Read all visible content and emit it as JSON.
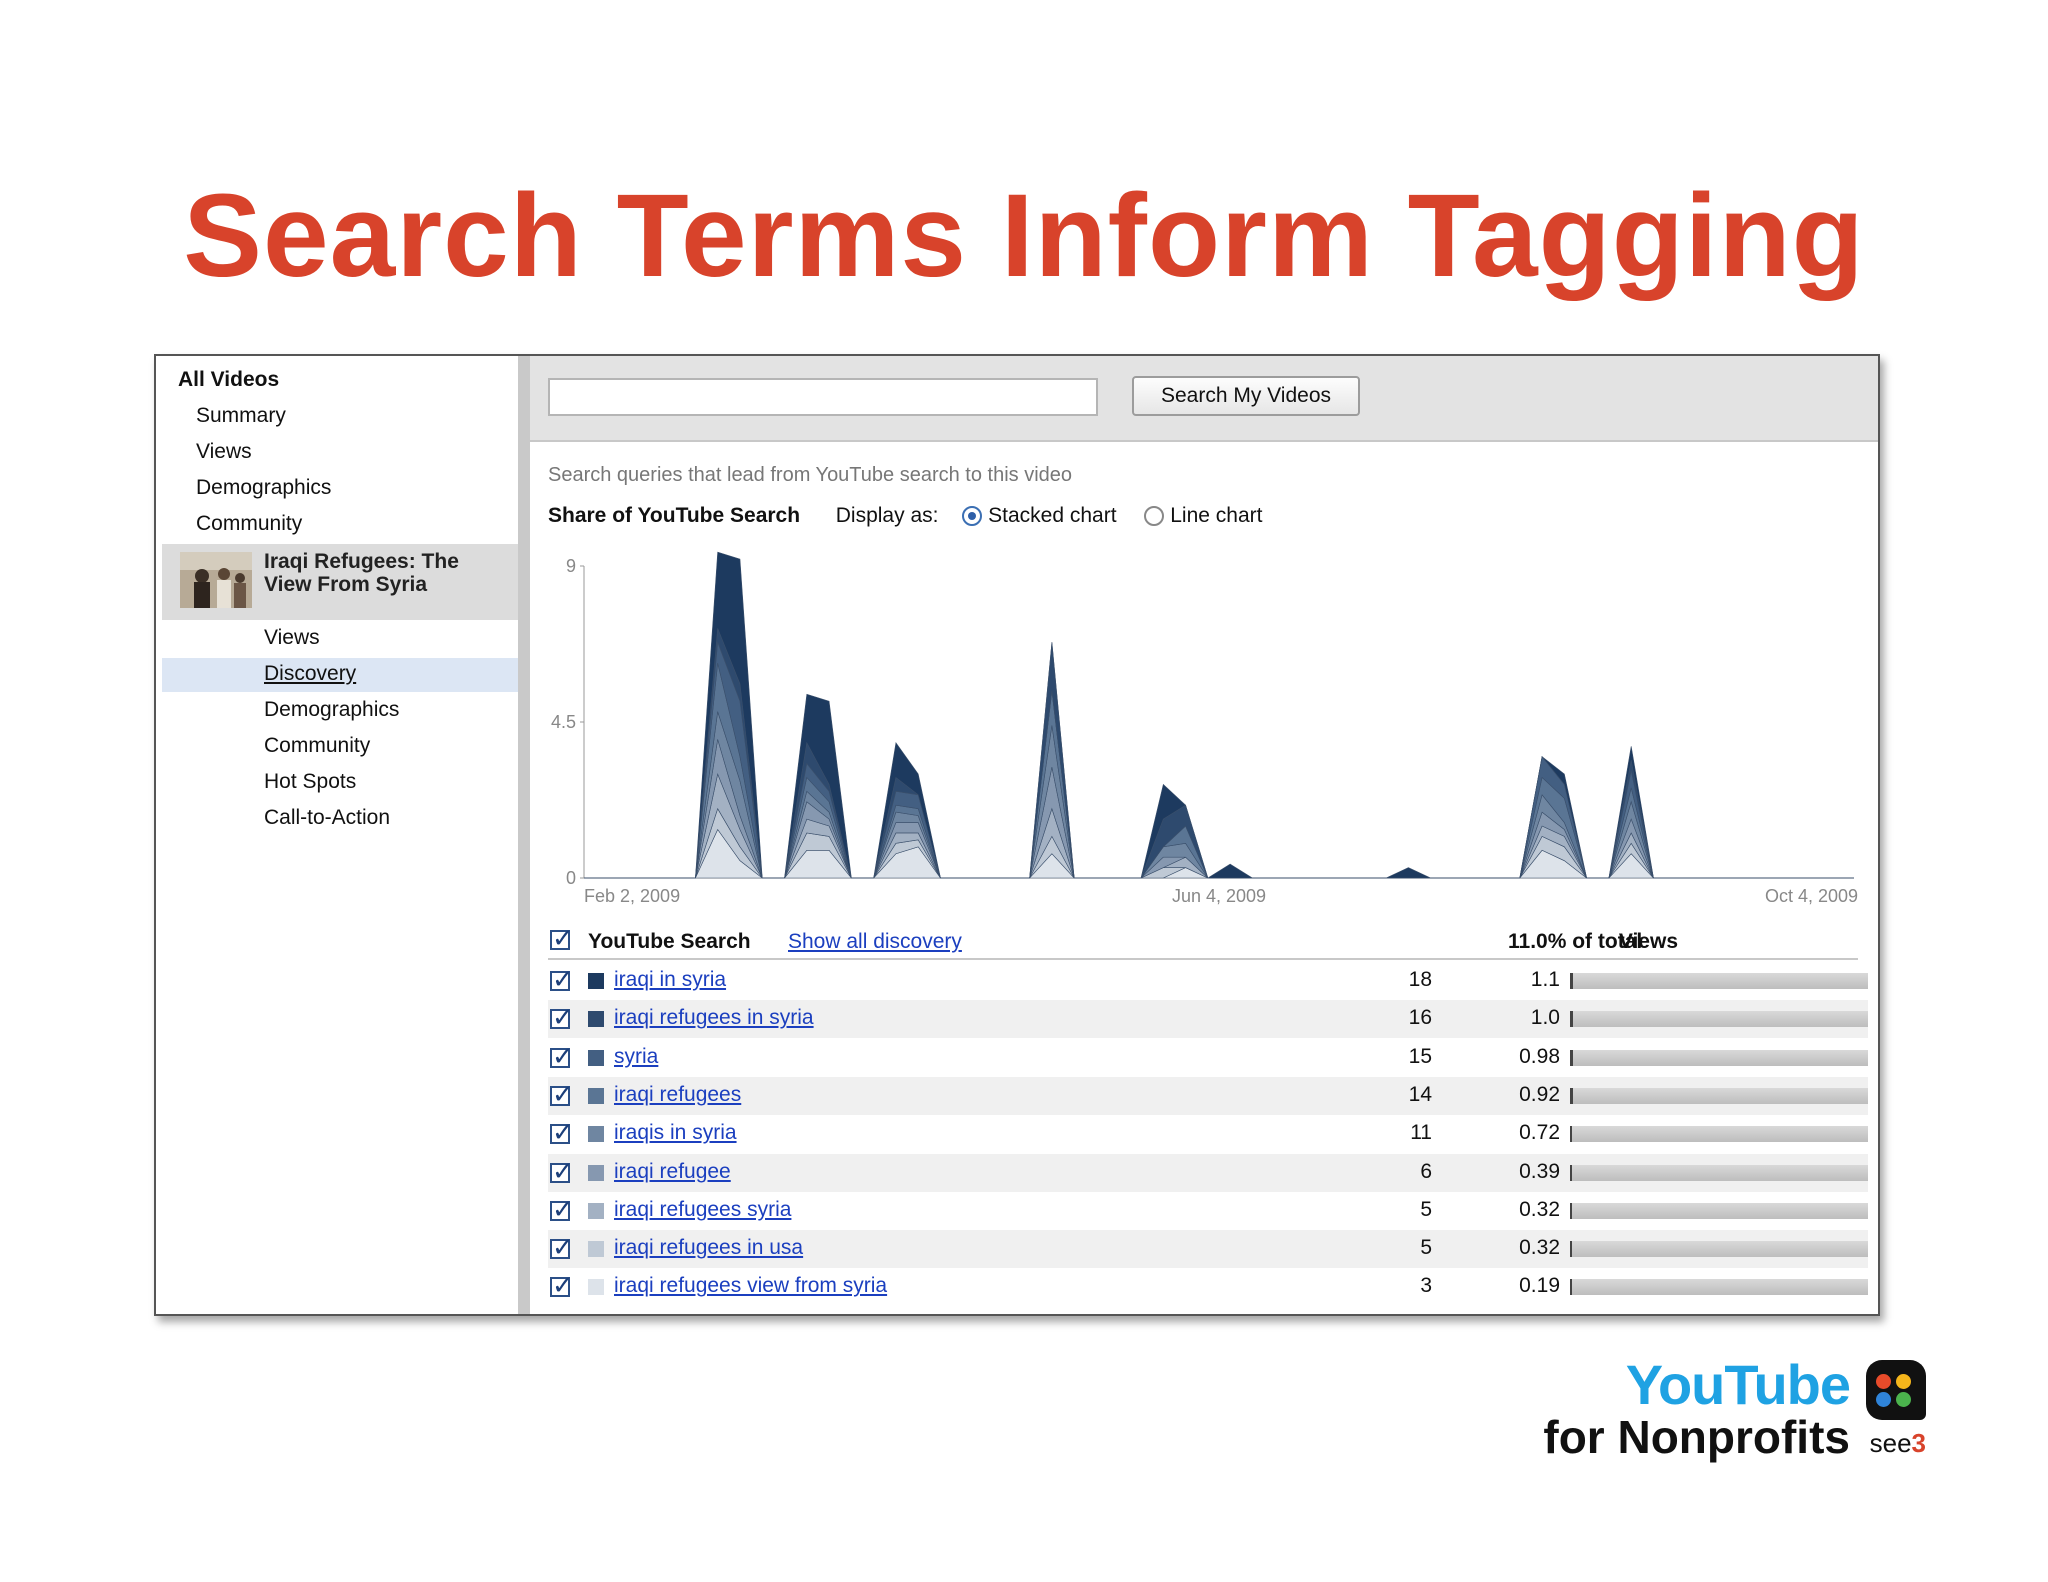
{
  "slide_title": "Search Terms Inform Tagging",
  "sidebar": {
    "all_videos": "All Videos",
    "items": [
      "Summary",
      "Views",
      "Demographics",
      "Community"
    ],
    "video_title_line1": "Iraqi Refugees: The",
    "video_title_line2": "View From Syria",
    "video_items": [
      "Views",
      "Discovery",
      "Demographics",
      "Community",
      "Hot Spots",
      "Call-to-Action"
    ],
    "selected": "Discovery"
  },
  "search": {
    "input_value": "",
    "button_label": "Search My Videos"
  },
  "discovery": {
    "description": "Search queries that lead from YouTube search to this video",
    "share_label": "Share of YouTube Search",
    "display_as_label": "Display as:",
    "stacked_label": "Stacked chart",
    "line_label": "Line chart",
    "selected_display": "Stacked chart"
  },
  "chart_data": {
    "type": "area",
    "stacked": true,
    "yticks": [
      "9",
      "4.5",
      "0"
    ],
    "ylim": [
      0,
      9
    ],
    "xticks": [
      "Feb 2, 2009",
      "Jun 4, 2009",
      "Oct 4, 2009"
    ],
    "x_points": 58,
    "series": [
      {
        "name": "iraqi in syria",
        "color": "#1d3a5f",
        "values": [
          0,
          0,
          0,
          0,
          0,
          0,
          2.2,
          3.6,
          0,
          0,
          1.4,
          2.4,
          0,
          0,
          1.0,
          0.6,
          0,
          0,
          0,
          0,
          0,
          0,
          0,
          0,
          0,
          0,
          1.0,
          0,
          0,
          0.4,
          0,
          0,
          0,
          0,
          0,
          0,
          0,
          0.3,
          0,
          0,
          0,
          0,
          0,
          0,
          0.3,
          0,
          0,
          0.4,
          0,
          0,
          0,
          0,
          0,
          0,
          0,
          0,
          0,
          0
        ]
      },
      {
        "name": "iraqi refugees in syria",
        "color": "#2e4a6e",
        "values": [
          0,
          0,
          0,
          0,
          0,
          0,
          0.4,
          0.5,
          0,
          0,
          0.6,
          0.2,
          0,
          0,
          0.4,
          0,
          0,
          0,
          0,
          0,
          0,
          1.4,
          0,
          0,
          0,
          0,
          0.8,
          0.6,
          0,
          0,
          0,
          0,
          0,
          0,
          0,
          0,
          0,
          0,
          0,
          0,
          0,
          0,
          0,
          0,
          0,
          0,
          0,
          0.3,
          0,
          0,
          0,
          0,
          0,
          0,
          0,
          0,
          0,
          0
        ]
      },
      {
        "name": "syria",
        "color": "#435f82",
        "values": [
          0,
          0,
          0,
          0,
          0,
          0,
          0.6,
          1.6,
          0,
          0,
          0.4,
          0.3,
          0,
          0,
          0.4,
          0.4,
          0,
          0,
          0,
          0,
          0,
          0,
          0,
          0,
          0,
          0,
          0,
          0,
          0,
          0,
          0,
          0,
          0,
          0,
          0,
          0,
          0,
          0,
          0,
          0,
          0,
          0,
          0,
          0.6,
          0.4,
          0,
          0,
          0.5,
          0,
          0,
          0,
          0,
          0,
          0,
          0,
          0,
          0,
          0
        ]
      },
      {
        "name": "iraqi refugees",
        "color": "#5a7594",
        "values": [
          0,
          0,
          0,
          0,
          0,
          0,
          1.4,
          0.7,
          0,
          0,
          0.4,
          0.3,
          0,
          0,
          0.2,
          0.2,
          0,
          0,
          0,
          0,
          0,
          1.0,
          0,
          0,
          0,
          0,
          0,
          0.5,
          0,
          0,
          0,
          0,
          0,
          0,
          0,
          0,
          0,
          0,
          0,
          0,
          0,
          0,
          0,
          0.5,
          0.7,
          0,
          0,
          0.4,
          0,
          0,
          0,
          0,
          0,
          0,
          0,
          0,
          0,
          0
        ]
      },
      {
        "name": "iraqis in syria",
        "color": "#6f86a1",
        "values": [
          0,
          0,
          0,
          0,
          0,
          0,
          0.8,
          1.0,
          0,
          0,
          0.3,
          0.2,
          0,
          0,
          0.3,
          0.2,
          0,
          0,
          0,
          0,
          0,
          1.2,
          0,
          0,
          0,
          0,
          0.3,
          0.4,
          0,
          0,
          0,
          0,
          0,
          0,
          0,
          0,
          0,
          0,
          0,
          0,
          0,
          0,
          0,
          0.5,
          0.2,
          0,
          0,
          0.5,
          0,
          0,
          0,
          0,
          0,
          0,
          0,
          0,
          0,
          0
        ]
      },
      {
        "name": "iraqi refugee",
        "color": "#8698b0",
        "values": [
          0,
          0,
          0,
          0,
          0,
          0,
          1.0,
          0.4,
          0,
          0,
          0.5,
          0.2,
          0,
          0,
          0.3,
          0.3,
          0,
          0,
          0,
          0,
          0,
          1.2,
          0,
          0,
          0,
          0,
          0.3,
          0,
          0,
          0,
          0,
          0,
          0,
          0,
          0,
          0,
          0,
          0,
          0,
          0,
          0,
          0,
          0,
          0.4,
          0.2,
          0,
          0,
          0.4,
          0,
          0,
          0,
          0,
          0,
          0,
          0,
          0,
          0,
          0
        ]
      },
      {
        "name": "iraqi refugees syria",
        "color": "#a3b1c3",
        "values": [
          0,
          0,
          0,
          0,
          0,
          0,
          1.0,
          0.5,
          0,
          0,
          0.4,
          0.3,
          0,
          0,
          0.3,
          0.2,
          0,
          0,
          0,
          0,
          0,
          0.8,
          0,
          0,
          0,
          0,
          0,
          0.3,
          0,
          0,
          0,
          0,
          0,
          0,
          0,
          0,
          0,
          0,
          0,
          0,
          0,
          0,
          0,
          0.3,
          0.3,
          0,
          0,
          0.3,
          0,
          0,
          0,
          0,
          0,
          0,
          0,
          0,
          0,
          0
        ]
      },
      {
        "name": "iraqi refugees in usa",
        "color": "#bfc9d5",
        "values": [
          0,
          0,
          0,
          0,
          0,
          0,
          0.6,
          0.4,
          0,
          0,
          0.5,
          0.4,
          0,
          0,
          0.3,
          0.2,
          0,
          0,
          0,
          0,
          0,
          0.5,
          0,
          0,
          0,
          0,
          0.3,
          0,
          0,
          0,
          0,
          0,
          0,
          0,
          0,
          0,
          0,
          0,
          0,
          0,
          0,
          0,
          0,
          0.4,
          0.4,
          0,
          0,
          0.3,
          0,
          0,
          0,
          0,
          0,
          0,
          0,
          0,
          0,
          0
        ]
      },
      {
        "name": "iraqi refugees view from syria",
        "color": "#dde3ea",
        "values": [
          0,
          0,
          0,
          0,
          0,
          0,
          1.4,
          0.5,
          0,
          0,
          0.8,
          0.8,
          0,
          0,
          0.7,
          0.9,
          0,
          0,
          0,
          0,
          0,
          0.7,
          0,
          0,
          0,
          0,
          0,
          0.3,
          0,
          0,
          0,
          0,
          0,
          0,
          0,
          0,
          0,
          0,
          0,
          0,
          0,
          0,
          0,
          0.8,
          0.5,
          0,
          0,
          0.7,
          0,
          0,
          0,
          0,
          0,
          0,
          0,
          0,
          0,
          0
        ]
      }
    ]
  },
  "table": {
    "header_label": "YouTube Search",
    "show_all_label": "Show all discovery",
    "views_header": "Views",
    "pct_header": "11.0% of total",
    "rows": [
      {
        "term": "iraqi in syria",
        "views": "18",
        "pct": "1.1",
        "fraction": 0.011,
        "color": "#1d3a5f"
      },
      {
        "term": "iraqi refugees in syria",
        "views": "16",
        "pct": "1.0",
        "fraction": 0.01,
        "color": "#2e4a6e"
      },
      {
        "term": "syria",
        "views": "15",
        "pct": "0.98",
        "fraction": 0.0098,
        "color": "#435f82"
      },
      {
        "term": "iraqi refugees",
        "views": "14",
        "pct": "0.92",
        "fraction": 0.0092,
        "color": "#5a7594"
      },
      {
        "term": "iraqis in syria",
        "views": "11",
        "pct": "0.72",
        "fraction": 0.0072,
        "color": "#6f86a1"
      },
      {
        "term": "iraqi refugee",
        "views": "6",
        "pct": "0.39",
        "fraction": 0.0039,
        "color": "#8698b0"
      },
      {
        "term": "iraqi refugees syria",
        "views": "5",
        "pct": "0.32",
        "fraction": 0.0032,
        "color": "#a3b1c3"
      },
      {
        "term": "iraqi refugees in usa",
        "views": "5",
        "pct": "0.32",
        "fraction": 0.0032,
        "color": "#bfc9d5"
      },
      {
        "term": "iraqi refugees view from syria",
        "views": "3",
        "pct": "0.19",
        "fraction": 0.0019,
        "color": "#dde3ea"
      }
    ]
  },
  "branding": {
    "youtube": "YouTube",
    "nonprofits": "for Nonprofits",
    "see": "see",
    "three": "3",
    "accent": "#d8432b"
  }
}
